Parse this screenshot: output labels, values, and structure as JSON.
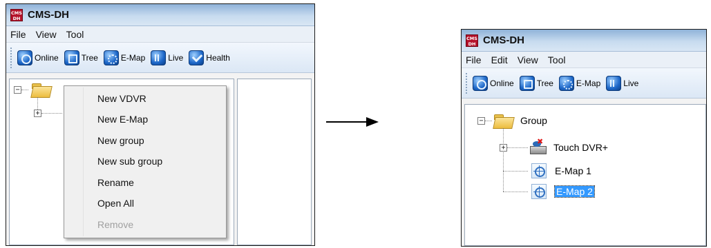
{
  "before": {
    "app": {
      "logo_text": "CMS DH",
      "title": "CMS-DH"
    },
    "menu": [
      "File",
      "View",
      "Tool"
    ],
    "toolbar": [
      "Online",
      "Tree",
      "E-Map",
      "Live",
      "Health"
    ],
    "context_menu": {
      "items": [
        {
          "label": "New VDVR",
          "enabled": true
        },
        {
          "label": "New E-Map",
          "enabled": true
        },
        {
          "label": "New group",
          "enabled": true
        },
        {
          "label": "New sub group",
          "enabled": true
        },
        {
          "label": "Rename",
          "enabled": true
        },
        {
          "label": "Open All",
          "enabled": true
        },
        {
          "label": "Remove",
          "enabled": false
        }
      ]
    }
  },
  "after": {
    "app": {
      "logo_text": "CMS DH",
      "title": "CMS-DH"
    },
    "menu": [
      "File",
      "Edit",
      "View",
      "Tool"
    ],
    "toolbar": [
      "Online",
      "Tree",
      "E-Map",
      "Live"
    ],
    "tree": {
      "root": "Group",
      "children": [
        {
          "label": "Touch DVR+",
          "icon": "dvr-icon"
        },
        {
          "label": "E-Map 1",
          "icon": "emap-icon"
        },
        {
          "label": "E-Map 2",
          "icon": "emap-icon",
          "selected": true
        }
      ]
    }
  },
  "colors": {
    "selection": "#3399ff",
    "logo": "#b5122b"
  }
}
